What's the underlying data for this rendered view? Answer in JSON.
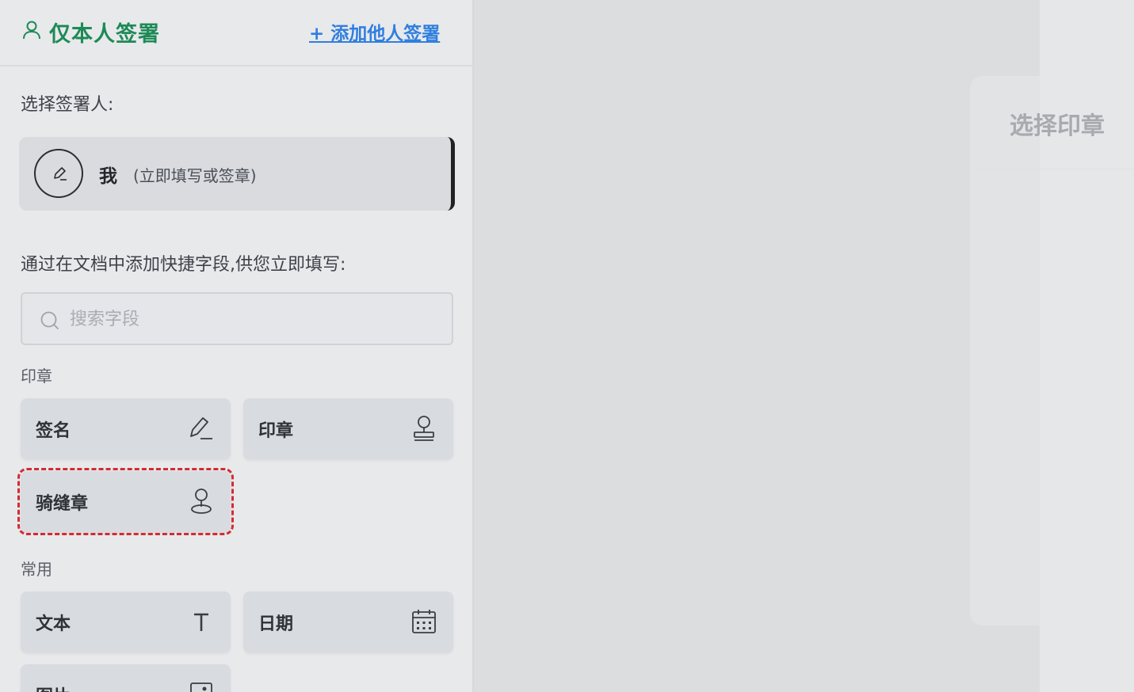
{
  "header": {
    "mode_title": "仅本人签署",
    "add_signer_link": "+ 添加他人签署"
  },
  "signer_section": {
    "label": "选择签署人:",
    "signer": {
      "name": "我",
      "note": "(立即填写或签章)"
    }
  },
  "fields_section": {
    "label": "通过在文档中添加快捷字段,供您立即填写:",
    "search_placeholder": "搜索字段"
  },
  "groups": [
    {
      "title": "印章",
      "items": [
        {
          "label": "签名",
          "icon": "pen-icon"
        },
        {
          "label": "印章",
          "icon": "stamp-icon"
        },
        {
          "label": "骑缝章",
          "icon": "seam-stamp-icon",
          "highlighted": true
        }
      ]
    },
    {
      "title": "常用",
      "items": [
        {
          "label": "文本",
          "icon": "text-icon"
        },
        {
          "label": "日期",
          "icon": "calendar-icon"
        },
        {
          "label": "图片",
          "icon": "image-icon"
        }
      ]
    }
  ],
  "stamp_panel": {
    "title": "选择印章"
  },
  "colors": {
    "brand_green": "#1d8a57",
    "link_blue": "#2f7fe0",
    "highlight_red": "#d22b35"
  }
}
